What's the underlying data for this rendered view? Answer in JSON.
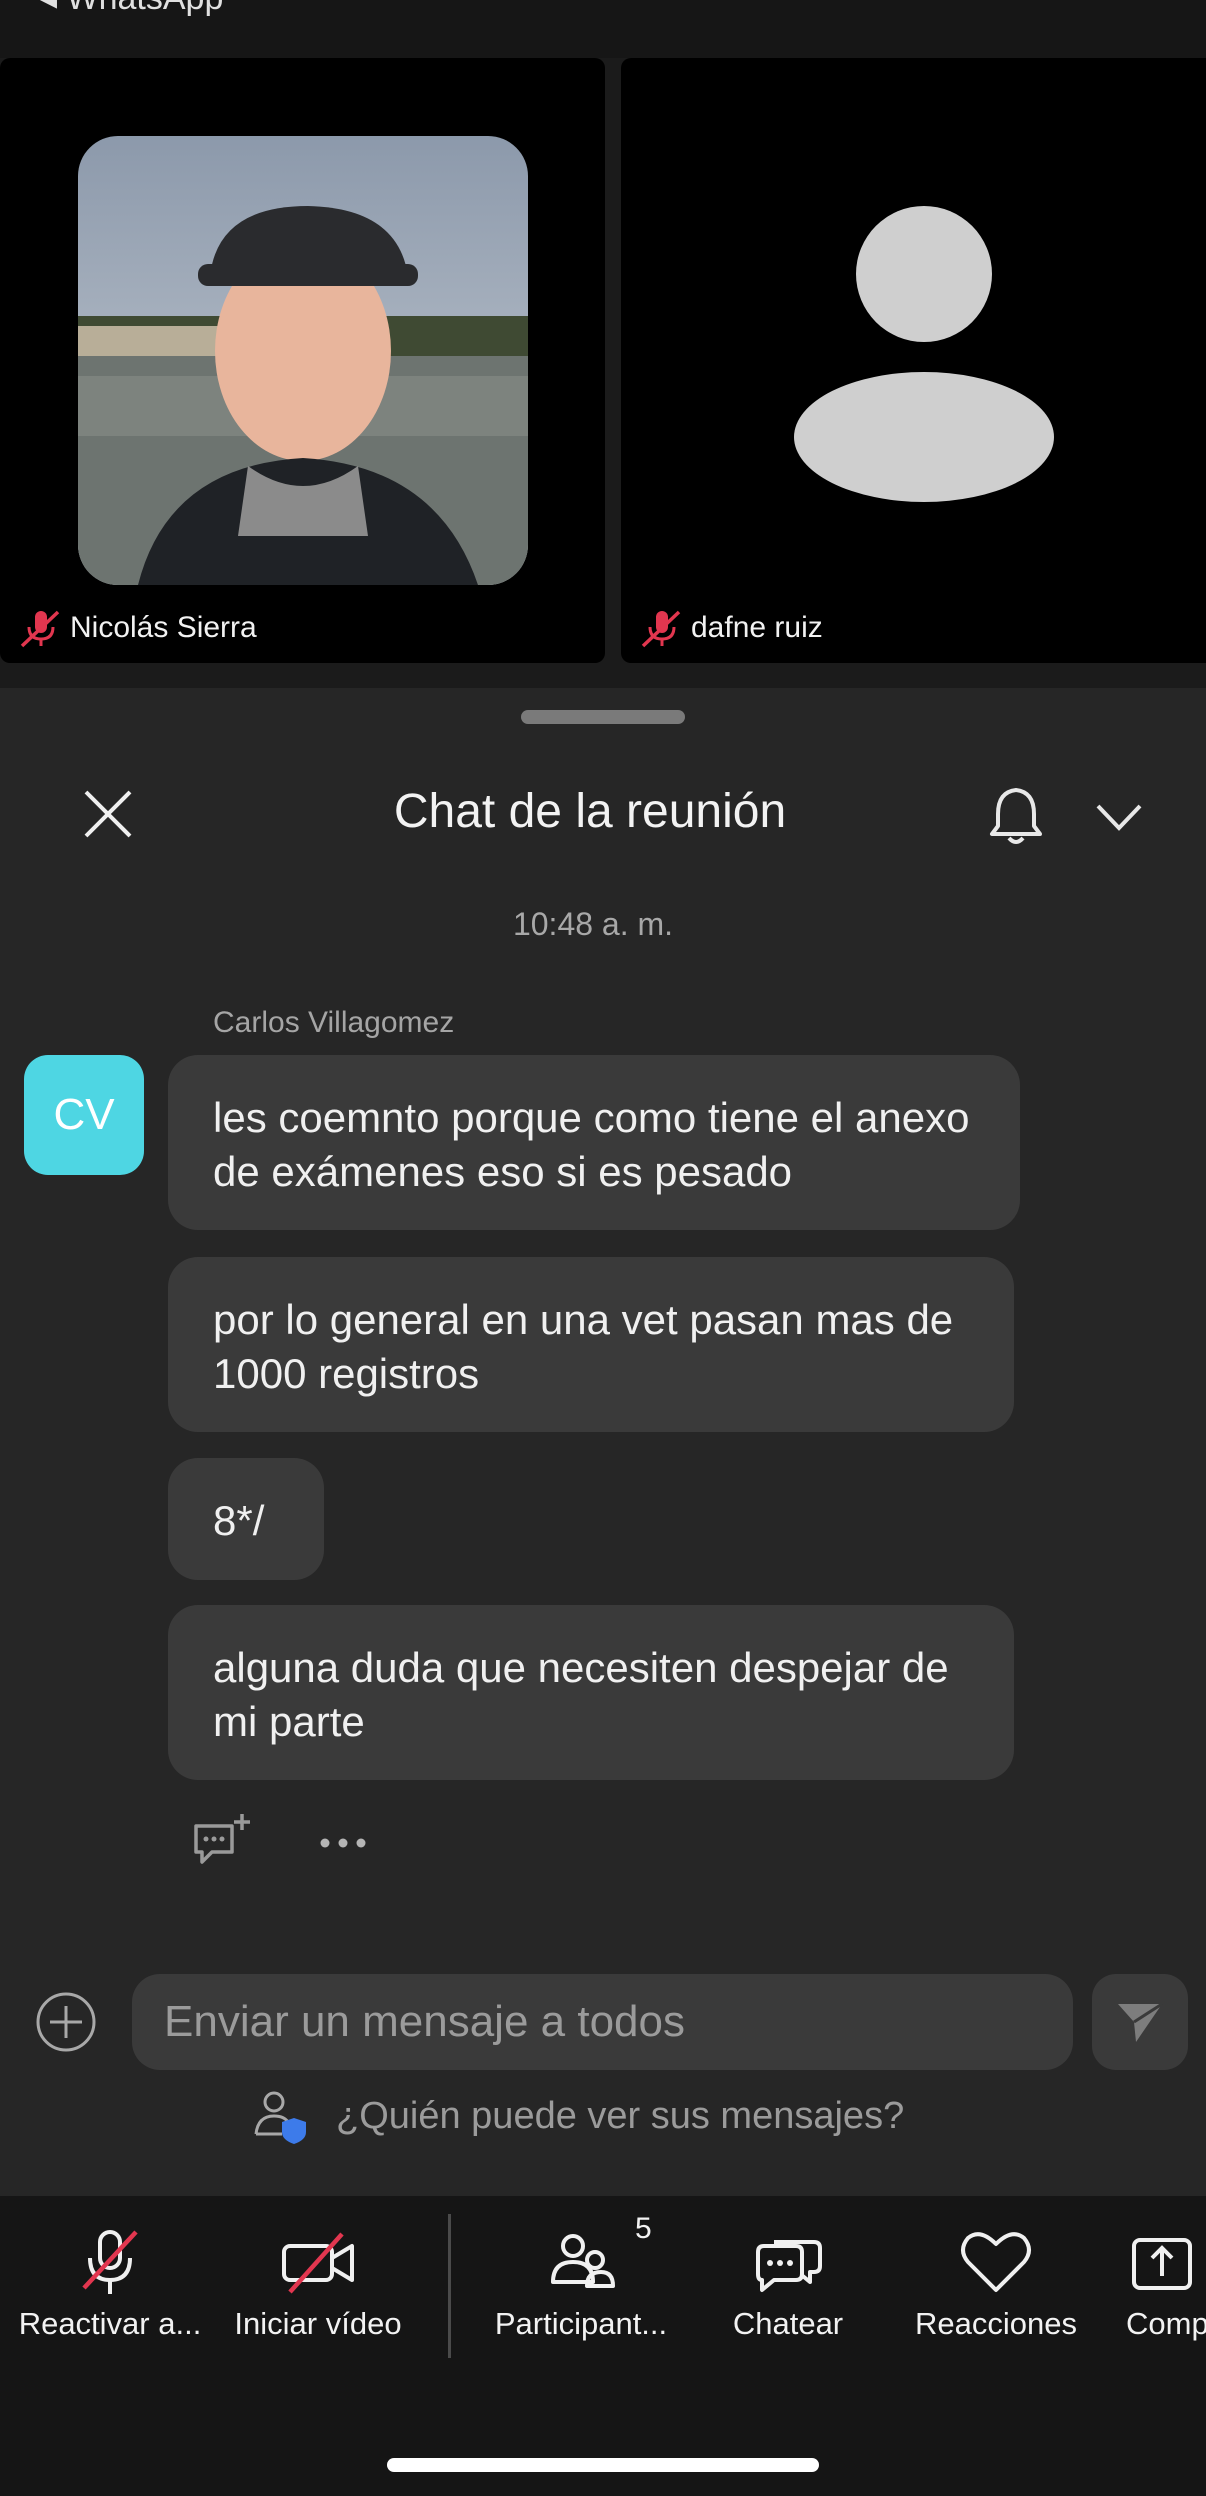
{
  "status": {
    "back_app": "◂ WhatsApp"
  },
  "participants_tiles": [
    {
      "name": "Nicolás Sierra",
      "muted": true
    },
    {
      "name": "dafne ruiz",
      "muted": true
    }
  ],
  "chat": {
    "title": "Chat de la reunión",
    "timestamp": "10:48 a. m.",
    "sender": "Carlos Villagomez",
    "avatar_initials": "CV",
    "avatar_color": "#4ed6e3",
    "messages": [
      "les coemnto porque como tiene el anexo de exámenes eso si es pesado",
      "por lo general en una vet pasan mas de 1000 registros",
      "8*/",
      "alguna duda que necesiten despejar de mi parte"
    ],
    "message_actions": {
      "add_reaction_icon": "comment-plus-icon",
      "more_icon": "ellipsis-icon"
    }
  },
  "composer": {
    "placeholder": "Enviar un mensaje a todos",
    "value": "",
    "who_can_see": "¿Quién puede ver sus mensajes?"
  },
  "toolbar": {
    "items": [
      {
        "label": "Reactivar a...",
        "icon": "mic-off-icon"
      },
      {
        "label": "Iniciar vídeo",
        "icon": "video-off-icon"
      },
      {
        "label": "Participant...",
        "icon": "participants-icon",
        "badge": "5"
      },
      {
        "label": "Chatear",
        "icon": "chat-icon"
      },
      {
        "label": "Reacciones",
        "icon": "heart-icon"
      },
      {
        "label": "Comp",
        "icon": "share-icon"
      }
    ]
  },
  "colors": {
    "muted_red": "#e2364f",
    "accent_cyan": "#4ed6e3"
  }
}
